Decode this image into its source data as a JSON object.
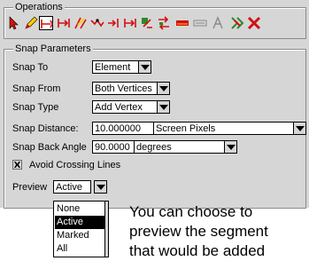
{
  "operations": {
    "legend": "Operations",
    "tools": [
      {
        "icon": "select-arrow-icon",
        "color": "#d01010"
      },
      {
        "icon": "edit-pencil-icon",
        "color": "#d01010"
      },
      {
        "icon": "snap-segment-icon",
        "color": "#d01010"
      },
      {
        "icon": "snap-vertex-icon",
        "color": "#d01010"
      },
      {
        "icon": "reshape-icon",
        "color": "#d01010"
      },
      {
        "icon": "vertex-move-icon",
        "color": "#d01010"
      },
      {
        "icon": "extend-icon",
        "color": "#d01010"
      },
      {
        "icon": "split-icon",
        "color": "#d01010"
      },
      {
        "icon": "add-point-icon",
        "color": "#d01010"
      },
      {
        "icon": "flip-icon",
        "color": "#d01010"
      },
      {
        "icon": "abc-text-icon",
        "color": "#d01010"
      },
      {
        "icon": "abc-outline-icon",
        "color": "#888888"
      },
      {
        "icon": "measure-icon",
        "color": "#888888"
      },
      {
        "icon": "merge-icon",
        "color": "#d01010"
      },
      {
        "icon": "delete-x-icon",
        "color": "#d01010"
      }
    ]
  },
  "snap": {
    "legend": "Snap Parameters",
    "snap_to_label": "Snap To",
    "snap_to_value": "Element",
    "snap_from_label": "Snap From",
    "snap_from_value": "Both Vertices",
    "snap_type_label": "Snap Type",
    "snap_type_value": "Add Vertex",
    "snap_distance_label": "Snap Distance:",
    "snap_distance_value": "10.000000",
    "snap_distance_unit": "Screen Pixels",
    "snap_angle_label": "Snap Back Angle",
    "snap_angle_value": "90.0000",
    "snap_angle_unit": "degrees",
    "avoid_crossing_label": "Avoid Crossing Lines",
    "avoid_crossing_checked": true,
    "preview_label": "Preview",
    "preview_value": "Active",
    "preview_options": [
      "None",
      "Active",
      "Marked",
      "All"
    ],
    "preview_selected_index": 1
  },
  "caption": {
    "line1": "You can choose to",
    "line2": "preview the segment",
    "line3": "that would be added"
  }
}
